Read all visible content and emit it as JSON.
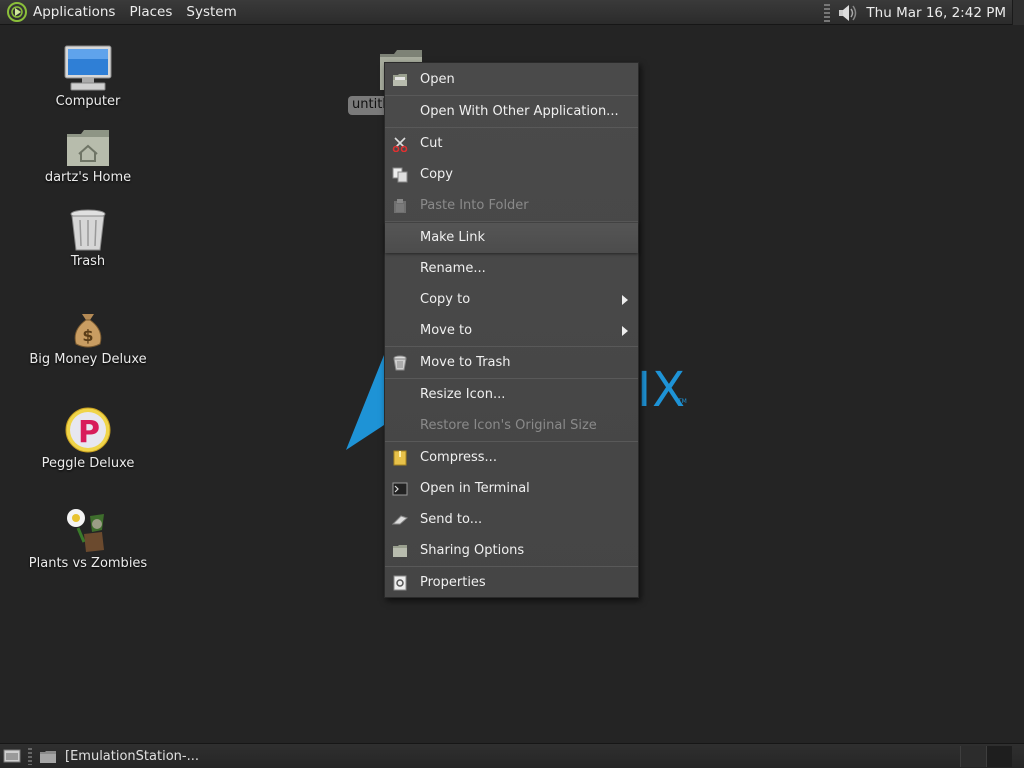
{
  "top_panel": {
    "menus": [
      "Applications",
      "Places",
      "System"
    ],
    "clock": "Thu Mar 16,  2:42 PM"
  },
  "desktop": {
    "icons": [
      {
        "label": "Computer",
        "icon": "computer-icon"
      },
      {
        "label": "dartz's Home",
        "icon": "home-folder-icon"
      },
      {
        "label": "Trash",
        "icon": "trash-icon"
      },
      {
        "label": "Big Money Deluxe",
        "icon": "money-bag-icon"
      },
      {
        "label": "Peggle Deluxe",
        "icon": "peggle-icon"
      },
      {
        "label": "Plants vs Zombies",
        "icon": "plants-vs-zombies-icon"
      }
    ],
    "selected_folder_label": "untitl",
    "wallpaper_text": "IX",
    "wallpaper_tm": "TM"
  },
  "context_menu": {
    "items": [
      {
        "label": "Open",
        "icon": "open-folder-icon",
        "enabled": true
      },
      {
        "label": "Open With Other Application...",
        "icon": "",
        "enabled": true
      },
      {
        "label": "Cut",
        "icon": "scissors-icon",
        "enabled": true
      },
      {
        "label": "Copy",
        "icon": "copy-icon",
        "enabled": true
      },
      {
        "label": "Paste Into Folder",
        "icon": "clipboard-icon",
        "enabled": false
      },
      {
        "label": "Make Link",
        "icon": "",
        "enabled": true
      },
      {
        "label": "Rename...",
        "icon": "",
        "enabled": true
      },
      {
        "label": "Copy to",
        "icon": "",
        "enabled": true,
        "submenu": true
      },
      {
        "label": "Move to",
        "icon": "",
        "enabled": true,
        "submenu": true
      },
      {
        "label": "Move to Trash",
        "icon": "trash-icon",
        "enabled": true
      },
      {
        "label": "Resize Icon...",
        "icon": "",
        "enabled": true
      },
      {
        "label": "Restore Icon's Original Size",
        "icon": "",
        "enabled": false
      },
      {
        "label": "Compress...",
        "icon": "archive-icon",
        "enabled": true
      },
      {
        "label": "Open in Terminal",
        "icon": "terminal-icon",
        "enabled": true
      },
      {
        "label": "Send to...",
        "icon": "send-icon",
        "enabled": true
      },
      {
        "label": "Sharing Options",
        "icon": "shared-folder-icon",
        "enabled": true
      },
      {
        "label": "Properties",
        "icon": "properties-icon",
        "enabled": true
      }
    ],
    "highlighted_item": "Make Link"
  },
  "bottom_panel": {
    "task_title": "[EmulationStation-..."
  },
  "colors": {
    "desktop_bg": "#242424",
    "menu_bg": "#4a4a4a",
    "wallpaper_accent": "#1e93d6"
  }
}
